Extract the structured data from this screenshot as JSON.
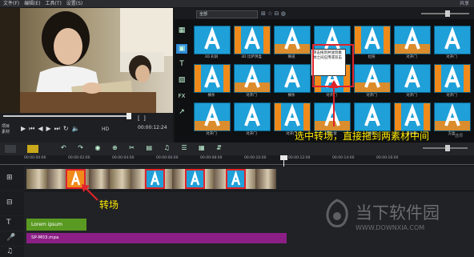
{
  "menu": {
    "items": [
      "文件(F)",
      "编辑(E)",
      "工具(T)",
      "设置(S)"
    ],
    "right": "共享"
  },
  "preview": {
    "modes": [
      "项目",
      "素材"
    ],
    "timecode": "00:00:12:24"
  },
  "library": {
    "category_select": "全部",
    "thumbnails": [
      "3D 彩屏",
      "3D 比萨饼盒",
      "横道",
      "扭曲",
      "拉链",
      "对开门",
      "对开门",
      "横条",
      "对开门",
      "横条",
      "对开门",
      "对开门",
      "对开门",
      "对开门",
      "对开门",
      "对开门",
      "对开门",
      "百叶窗",
      "横条",
      "百叶窗",
      "方盒"
    ],
    "tooltip": "单击拖到并放到素材之间应用或双击",
    "options_label": "选项"
  },
  "timeline": {
    "ruler": [
      "00:00:00:00",
      "00:00:02:00",
      "00:00:04:00",
      "00:00:06:00",
      "00:00:08:00",
      "00:00:10:00",
      "00:00:12:00",
      "00:00:14:00",
      "00:00:16:00"
    ],
    "title_clip": "Lorem ipsum",
    "music_clip": "SP-M03.mpa"
  },
  "annotations": {
    "top": "选中转场，直接拖到两素材中间",
    "bottom": "转场"
  },
  "watermark": {
    "name": "当下软件园",
    "url": "WWW.DOWNXIA.COM"
  },
  "colors": {
    "accent": "#1fa0d8",
    "highlight": "#e0242b",
    "annotation": "#ffea00",
    "title_track": "#5a9a22",
    "music_track": "#8b1f86"
  }
}
